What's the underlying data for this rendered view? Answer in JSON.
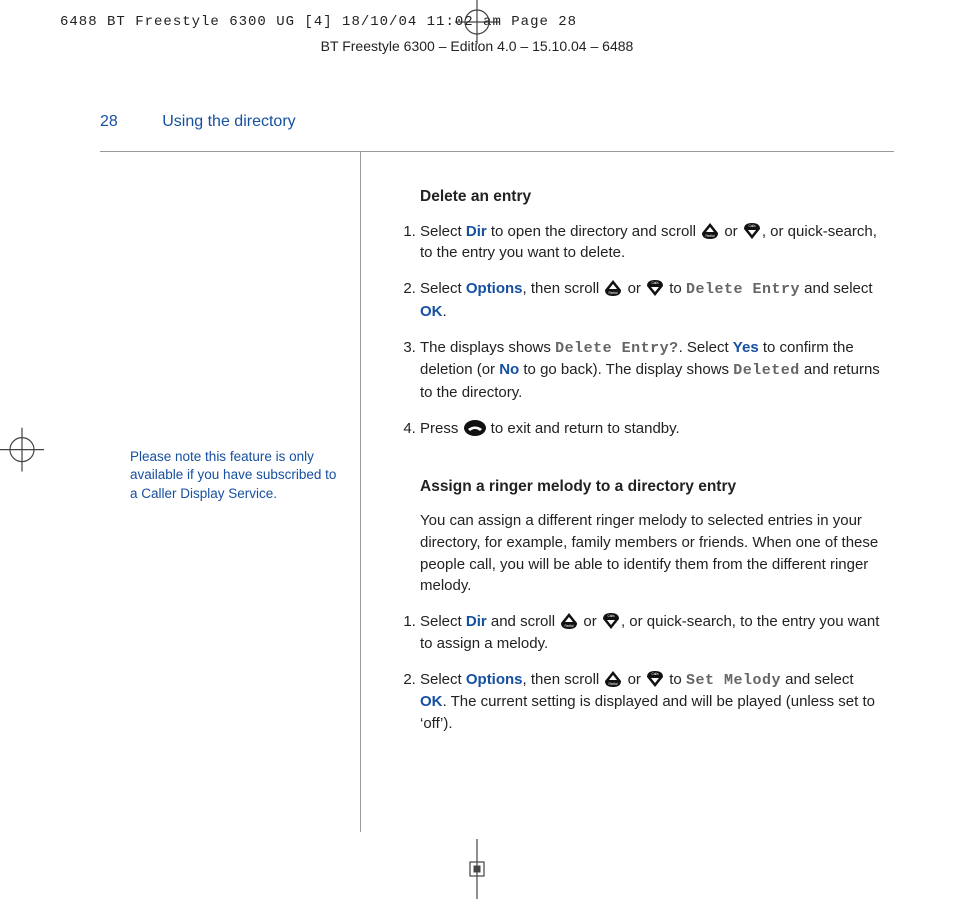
{
  "crop_header": "6488 BT Freestyle 6300 UG [4]  18/10/04  11:02 am  Page 28",
  "edition_line": "BT Freestyle 6300 – Edition 4.0 – 15.10.04 – 6488",
  "page_number": "28",
  "running_head": "Using the directory",
  "side_note": "Please note this feature is only available if you have subscribed to a Caller Display Service.",
  "section1": {
    "heading": "Delete an entry",
    "step1_a": "Select ",
    "step1_dir": "Dir",
    "step1_b": " to open the directory and scroll ",
    "step1_or": " or ",
    "step1_c": ", or quick-search, to the entry you want to delete.",
    "step2_a": "Select ",
    "step2_opt": "Options",
    "step2_b": ", then scroll ",
    "step2_or": " or ",
    "step2_c": " to ",
    "step2_lcd": "Delete Entry",
    "step2_d": " and select ",
    "step2_ok": "OK",
    "step2_e": ".",
    "step3_a": "The displays shows ",
    "step3_lcd1": "Delete Entry?",
    "step3_b": ". Select ",
    "step3_yes": "Yes",
    "step3_c": " to confirm the deletion (or ",
    "step3_no": "No",
    "step3_d": " to go back). The display shows ",
    "step3_lcd2": "Deleted",
    "step3_e": " and returns to the directory.",
    "step4_a": "Press ",
    "step4_b": " to exit and return to standby."
  },
  "section2": {
    "heading": "Assign a ringer melody to a directory entry",
    "intro": "You can assign a different ringer melody to selected entries in your directory, for example, family members or friends. When one of these people call, you will be able to identify them from the different ringer melody.",
    "step1_a": "Select ",
    "step1_dir": "Dir",
    "step1_b": " and scroll ",
    "step1_or": " or ",
    "step1_c": ", or quick-search, to the entry you want to assign a melody.",
    "step2_a": "Select ",
    "step2_opt": "Options",
    "step2_b": ", then scroll ",
    "step2_or": " or ",
    "step2_c": " to ",
    "step2_lcd": "Set Melody",
    "step2_d": " and select ",
    "step2_ok": "OK",
    "step2_e": ". The current setting is displayed and will be played (unless set to ‘off’)."
  }
}
